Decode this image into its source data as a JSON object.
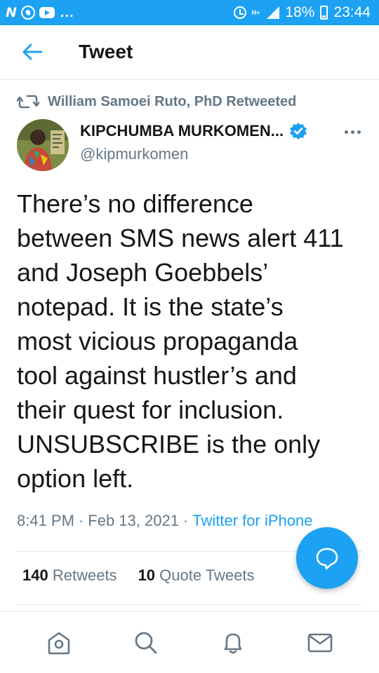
{
  "status_bar": {
    "notif_n": "N",
    "dots": "...",
    "ht": "H+",
    "battery": "18%",
    "time": "23:44"
  },
  "header": {
    "back_icon": "arrow-left-icon",
    "title": "Tweet"
  },
  "retweet_context": {
    "icon": "retweet-icon",
    "text": "William Samoei Ruto, PhD Retweeted"
  },
  "tweet": {
    "author_name": "KIPCHUMBA MURKOMEN...",
    "verified": true,
    "handle": "@kipmurkomen",
    "text": "There’s no difference\nbetween SMS news alert 411\nand Joseph Goebbels’\nnotepad. It is the state’s\nmost vicious propaganda\ntool against hustler’s and\ntheir quest for inclusion.\nUNSUBSCRIBE is the only\noption left.",
    "time": "8:41 PM",
    "date": "Feb 13, 2021",
    "source": "Twitter for iPhone",
    "separator": "·"
  },
  "stats": {
    "retweets_count": "140",
    "retweets_label": "Retweets",
    "quotes_count": "10",
    "quotes_label": "Quote Tweets"
  },
  "fab": {
    "icon": "compose-reply-icon"
  },
  "bottom_nav": {
    "items": [
      "home-icon",
      "search-icon",
      "notifications-icon",
      "messages-icon"
    ]
  },
  "colors": {
    "accent": "#1da1f2",
    "text_primary": "#14171a",
    "text_secondary": "#657786",
    "divider": "#e1e8ed"
  }
}
